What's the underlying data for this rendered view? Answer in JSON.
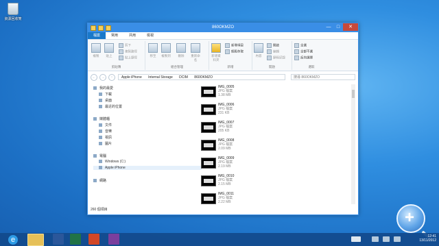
{
  "desktop": {
    "recycle_bin_label": "資源回收筒"
  },
  "window": {
    "title": "860OKMZO",
    "tabs": [
      "檔案",
      "常用",
      "共用",
      "檢視"
    ],
    "groups": {
      "clipboard": "剪貼簿",
      "organize": "組合管理",
      "new": "新增",
      "open": "開啟",
      "select": "選取"
    },
    "ribbon": {
      "copy": "複製",
      "paste": "貼上",
      "cut": "剪下",
      "copy_path": "複製路徑",
      "paste_shortcut": "貼上捷徑",
      "move_to": "移至",
      "copy_to": "複製到",
      "delete": "刪除",
      "rename": "重新命名",
      "new_folder": "新增資料夾",
      "new_item": "新增項目",
      "easy_access": "輕鬆存取",
      "properties": "內容",
      "open": "開啟",
      "edit": "編輯",
      "history": "歷程記錄",
      "select_all": "全選",
      "select_none": "全部不選",
      "invert": "反向選擇"
    },
    "address": {
      "parts": [
        "Apple iPhone",
        "Internal Storage",
        "DCIM",
        "860OKMZO"
      ],
      "search_placeholder": "搜尋 860OKMZO"
    },
    "nav": [
      {
        "label": "我的最愛"
      },
      {
        "label": "下載"
      },
      {
        "label": "桌面"
      },
      {
        "label": "最近的位置"
      },
      {
        "label": "媒體櫃"
      },
      {
        "label": "文件"
      },
      {
        "label": "音樂"
      },
      {
        "label": "視訊"
      },
      {
        "label": "圖片"
      },
      {
        "label": "電腦"
      },
      {
        "label": "Windows (C:)"
      },
      {
        "label": "Apple iPhone"
      },
      {
        "label": "網路"
      }
    ],
    "files": [
      {
        "name": "IMG_0005",
        "type": "JPG 檔案",
        "size": "1.38 MB"
      },
      {
        "name": "IMG_0006",
        "type": "JPG 檔案",
        "size": "231 KB"
      },
      {
        "name": "IMG_0007",
        "type": "JPG 檔案",
        "size": "205 KB"
      },
      {
        "name": "IMG_0008",
        "type": "JPG 檔案",
        "size": "2.09 MB"
      },
      {
        "name": "IMG_0009",
        "type": "JPG 檔案",
        "size": "2.19 MB"
      },
      {
        "name": "IMG_0010",
        "type": "JPG 檔案",
        "size": "2.15 MB"
      },
      {
        "name": "IMG_0011",
        "type": "JPG 檔案",
        "size": "2.22 MB"
      }
    ],
    "status": "260 個項目"
  },
  "taskbar": {
    "time": "12:41",
    "date": "13/11/2012"
  }
}
